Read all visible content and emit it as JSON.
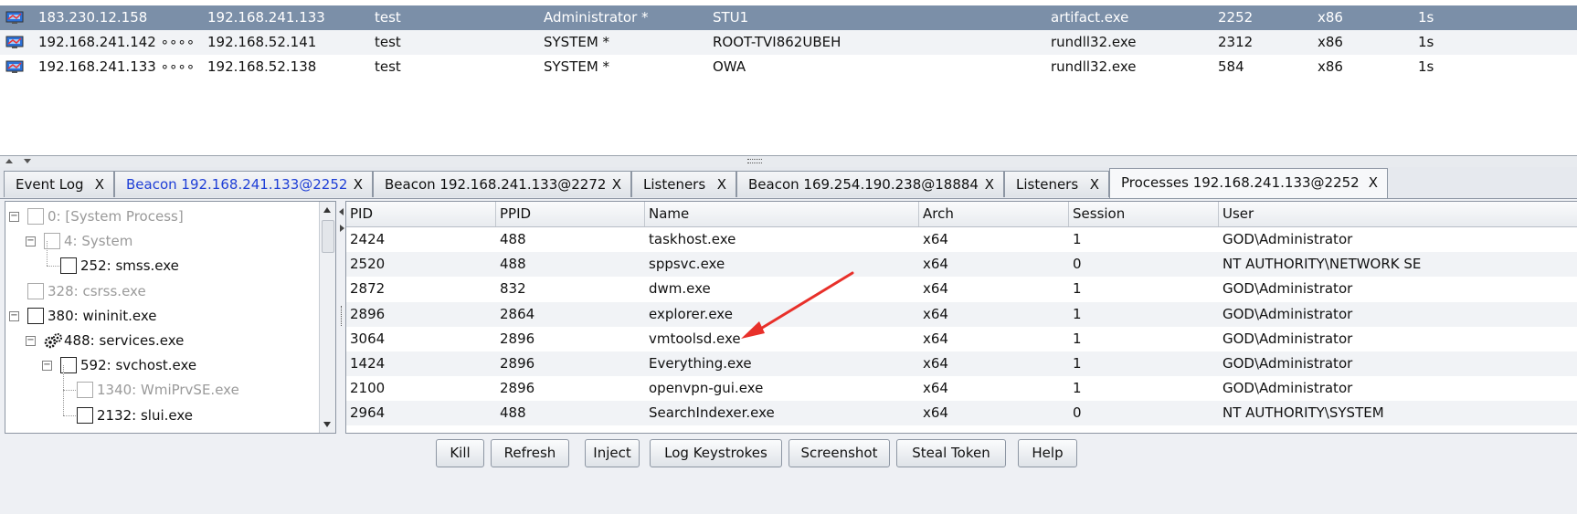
{
  "beacons": [
    {
      "external": "183.230.12.158",
      "internal": "192.168.241.133",
      "listener": "test",
      "user": "Administrator *",
      "computer": "STU1",
      "process": "artifact.exe",
      "pid": "2252",
      "arch": "x86",
      "last": "1s",
      "selected": true
    },
    {
      "external": "192.168.241.142 ∘∘∘∘",
      "internal": "192.168.52.141",
      "listener": "test",
      "user": "SYSTEM *",
      "computer": "ROOT-TVI862UBEH",
      "process": "rundll32.exe",
      "pid": "2312",
      "arch": "x86",
      "last": "1s",
      "selected": false
    },
    {
      "external": "192.168.241.133 ∘∘∘∘",
      "internal": "192.168.52.138",
      "listener": "test",
      "user": "SYSTEM *",
      "computer": "OWA",
      "process": "rundll32.exe",
      "pid": "584",
      "arch": "x86",
      "last": "1s",
      "selected": false
    }
  ],
  "tabs": [
    {
      "label": "Event Log",
      "close": "X",
      "active": false,
      "highlight": false
    },
    {
      "label": "Beacon 192.168.241.133@2252",
      "close": "X",
      "active": false,
      "highlight": true
    },
    {
      "label": "Beacon 192.168.241.133@2272",
      "close": "X",
      "active": false,
      "highlight": false
    },
    {
      "label": "Listeners",
      "close": "X",
      "active": false,
      "highlight": false
    },
    {
      "label": "Beacon 169.254.190.238@18884",
      "close": "X",
      "active": false,
      "highlight": false
    },
    {
      "label": "Listeners",
      "close": "X",
      "active": false,
      "highlight": false
    },
    {
      "label": "Processes 192.168.241.133@2252",
      "close": "X",
      "active": true,
      "highlight": false
    }
  ],
  "tree": [
    {
      "label": "0: [System Process]",
      "level": 0,
      "expander": "minus",
      "gray": true,
      "icon": "checkbox"
    },
    {
      "label": "4: System",
      "level": 1,
      "expander": "minus",
      "gray": true,
      "icon": "checkbox"
    },
    {
      "label": "252: smss.exe",
      "level": 2,
      "expander": "none",
      "gray": false,
      "icon": "checkbox"
    },
    {
      "label": "328: csrss.exe",
      "level": 0,
      "expander": "none",
      "gray": true,
      "icon": "checkbox"
    },
    {
      "label": "380: wininit.exe",
      "level": 0,
      "expander": "minus",
      "gray": false,
      "icon": "checkbox"
    },
    {
      "label": "488: services.exe",
      "level": 1,
      "expander": "minus",
      "gray": false,
      "icon": "gears"
    },
    {
      "label": "592: svchost.exe",
      "level": 2,
      "expander": "minus",
      "gray": false,
      "icon": "checkbox"
    },
    {
      "label": "1340: WmiPrvSE.exe",
      "level": 3,
      "expander": "none",
      "gray": true,
      "icon": "checkbox"
    },
    {
      "label": "2132: slui.exe",
      "level": 3,
      "expander": "none",
      "gray": false,
      "icon": "checkbox"
    }
  ],
  "process_table": {
    "columns": [
      "PID",
      "PPID",
      "Name",
      "Arch",
      "Session",
      "User"
    ],
    "rows": [
      [
        "2424",
        "488",
        "taskhost.exe",
        "x64",
        "1",
        "GOD\\Administrator"
      ],
      [
        "2520",
        "488",
        "sppsvc.exe",
        "x64",
        "0",
        "NT AUTHORITY\\NETWORK SE"
      ],
      [
        "2872",
        "832",
        "dwm.exe",
        "x64",
        "1",
        "GOD\\Administrator"
      ],
      [
        "2896",
        "2864",
        "explorer.exe",
        "x64",
        "1",
        "GOD\\Administrator"
      ],
      [
        "3064",
        "2896",
        "vmtoolsd.exe",
        "x64",
        "1",
        "GOD\\Administrator"
      ],
      [
        "1424",
        "2896",
        "Everything.exe",
        "x64",
        "1",
        "GOD\\Administrator"
      ],
      [
        "2100",
        "2896",
        "openvpn-gui.exe",
        "x64",
        "1",
        "GOD\\Administrator"
      ],
      [
        "2964",
        "488",
        "SearchIndexer.exe",
        "x64",
        "0",
        "NT AUTHORITY\\SYSTEM"
      ]
    ]
  },
  "buttons": [
    "Kill",
    "Refresh",
    "Inject",
    "Log Keystrokes",
    "Screenshot",
    "Steal Token",
    "Help"
  ],
  "colors": {
    "selected_row": "#7b8fa8",
    "annotation_arrow": "#e8302a",
    "highlight_tab": "#1f3fd6"
  }
}
